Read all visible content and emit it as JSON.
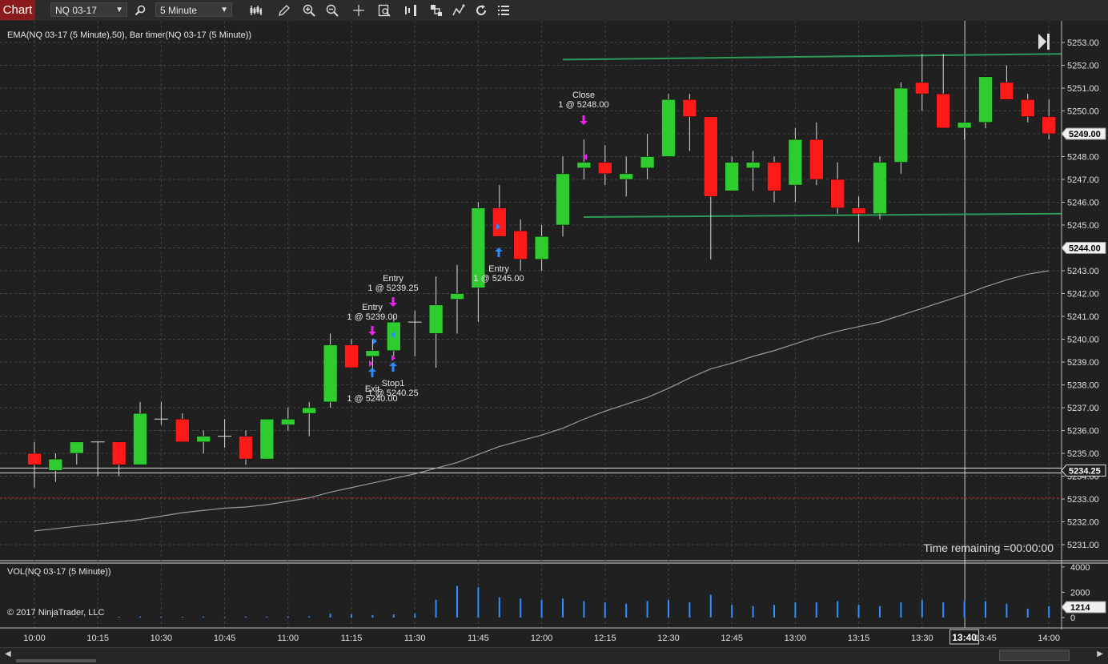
{
  "toolbar": {
    "tab_label": "Chart",
    "instrument": "NQ 03-17",
    "interval": "5 Minute",
    "icons": [
      "search-icon",
      "bars-type-icon",
      "pencil-icon",
      "zoom-in-icon",
      "zoom-out-icon",
      "crosshair-icon",
      "data-box-icon",
      "chart-trader-icon",
      "strategies-icon",
      "indicators-icon",
      "refresh-icon",
      "properties-icon"
    ]
  },
  "chart": {
    "indicator_label": "EMA(NQ 03-17 (5 Minute),50), Bar timer(NQ 03-17 (5 Minute))",
    "volume_label": "VOL(NQ 03-17 (5 Minute))",
    "copyright": "© 2017 NinjaTrader, LLC",
    "time_remaining": "Time remaining =00:00:00",
    "y_ticks": [
      "5253.00",
      "5252.00",
      "5251.00",
      "5250.00",
      "5249.00",
      "5248.00",
      "5247.00",
      "5246.00",
      "5245.00",
      "5244.00",
      "5243.00",
      "5242.00",
      "5241.00",
      "5240.00",
      "5239.00",
      "5238.00",
      "5237.00",
      "5236.00",
      "5235.00",
      "5234.00",
      "5233.00",
      "5232.00",
      "5231.00"
    ],
    "price_flags": [
      "5249.00",
      "5244.00",
      "5234.25"
    ],
    "vol_ticks": [
      "4000",
      "2000",
      "0"
    ],
    "vol_flag": "1214",
    "x_ticks": [
      "10:00",
      "10:15",
      "10:30",
      "10:45",
      "11:00",
      "11:15",
      "11:30",
      "11:45",
      "12:00",
      "12:15",
      "12:30",
      "12:45",
      "13:00",
      "13:15",
      "13:30",
      "13:40",
      "13:45",
      "14:00"
    ],
    "colors": {
      "up": "#2fcc2f",
      "down": "#ff1a1a",
      "volume": "#2f8fff",
      "ema": "#9a9a9a",
      "hline": "#2e9a5a"
    }
  },
  "chart_data": {
    "type": "candlestick",
    "instrument": "NQ 03-17",
    "interval": "5 Minute",
    "y_range": [
      5230.5,
      5253.5
    ],
    "bars": [
      {
        "t": "10:00",
        "o": 5235.0,
        "h": 5235.5,
        "l": 5233.5,
        "c": 5234.5
      },
      {
        "t": "10:05",
        "o": 5234.25,
        "h": 5235.0,
        "l": 5233.75,
        "c": 5234.75
      },
      {
        "t": "10:10",
        "o": 5235.0,
        "h": 5235.5,
        "l": 5234.5,
        "c": 5235.5
      },
      {
        "t": "10:15",
        "o": 5235.5,
        "h": 5235.5,
        "l": 5234.0,
        "c": 5235.5
      },
      {
        "t": "10:20",
        "o": 5235.5,
        "h": 5235.5,
        "l": 5234.0,
        "c": 5234.5
      },
      {
        "t": "10:25",
        "o": 5234.5,
        "h": 5237.25,
        "l": 5234.5,
        "c": 5236.75
      },
      {
        "t": "10:30",
        "o": 5236.5,
        "h": 5237.25,
        "l": 5236.25,
        "c": 5236.5
      },
      {
        "t": "10:35",
        "o": 5236.5,
        "h": 5236.75,
        "l": 5235.5,
        "c": 5235.5
      },
      {
        "t": "10:40",
        "o": 5235.5,
        "h": 5236.0,
        "l": 5235.0,
        "c": 5235.75
      },
      {
        "t": "10:45",
        "o": 5235.75,
        "h": 5236.5,
        "l": 5235.25,
        "c": 5235.75
      },
      {
        "t": "10:50",
        "o": 5235.75,
        "h": 5236.0,
        "l": 5234.5,
        "c": 5234.75
      },
      {
        "t": "10:55",
        "o": 5234.75,
        "h": 5236.5,
        "l": 5234.75,
        "c": 5236.5
      },
      {
        "t": "11:00",
        "o": 5236.25,
        "h": 5237.0,
        "l": 5236.0,
        "c": 5236.5
      },
      {
        "t": "11:05",
        "o": 5236.75,
        "h": 5237.25,
        "l": 5235.75,
        "c": 5237.0
      },
      {
        "t": "11:10",
        "o": 5237.25,
        "h": 5240.25,
        "l": 5237.0,
        "c": 5239.75
      },
      {
        "t": "11:15",
        "o": 5239.75,
        "h": 5240.0,
        "l": 5238.75,
        "c": 5238.75
      },
      {
        "t": "11:20",
        "o": 5239.25,
        "h": 5240.0,
        "l": 5238.5,
        "c": 5239.5
      },
      {
        "t": "11:25",
        "o": 5239.5,
        "h": 5241.0,
        "l": 5239.25,
        "c": 5240.75
      },
      {
        "t": "11:30",
        "o": 5240.75,
        "h": 5241.25,
        "l": 5239.25,
        "c": 5240.75
      },
      {
        "t": "11:35",
        "o": 5240.25,
        "h": 5242.75,
        "l": 5238.75,
        "c": 5241.5
      },
      {
        "t": "11:40",
        "o": 5241.75,
        "h": 5243.25,
        "l": 5240.25,
        "c": 5242.0
      },
      {
        "t": "11:45",
        "o": 5242.25,
        "h": 5246.0,
        "l": 5240.75,
        "c": 5245.75
      },
      {
        "t": "11:50",
        "o": 5245.75,
        "h": 5246.75,
        "l": 5244.5,
        "c": 5244.5
      },
      {
        "t": "11:55",
        "o": 5244.75,
        "h": 5245.25,
        "l": 5243.0,
        "c": 5243.5
      },
      {
        "t": "12:00",
        "o": 5243.5,
        "h": 5245.0,
        "l": 5243.0,
        "c": 5244.5
      },
      {
        "t": "12:05",
        "o": 5245.0,
        "h": 5248.0,
        "l": 5244.5,
        "c": 5247.25
      },
      {
        "t": "12:10",
        "o": 5247.5,
        "h": 5248.75,
        "l": 5247.0,
        "c": 5247.75
      },
      {
        "t": "12:15",
        "o": 5247.75,
        "h": 5248.5,
        "l": 5246.75,
        "c": 5247.25
      },
      {
        "t": "12:20",
        "o": 5247.0,
        "h": 5248.0,
        "l": 5246.25,
        "c": 5247.25
      },
      {
        "t": "12:25",
        "o": 5247.5,
        "h": 5249.0,
        "l": 5247.0,
        "c": 5248.0
      },
      {
        "t": "12:30",
        "o": 5248.0,
        "h": 5250.75,
        "l": 5248.0,
        "c": 5250.5
      },
      {
        "t": "12:35",
        "o": 5250.5,
        "h": 5250.75,
        "l": 5248.25,
        "c": 5249.75
      },
      {
        "t": "12:40",
        "o": 5249.75,
        "h": 5249.75,
        "l": 5243.5,
        "c": 5246.25
      },
      {
        "t": "12:45",
        "o": 5246.5,
        "h": 5248.0,
        "l": 5246.5,
        "c": 5247.75
      },
      {
        "t": "12:50",
        "o": 5247.5,
        "h": 5248.25,
        "l": 5246.5,
        "c": 5247.75
      },
      {
        "t": "12:55",
        "o": 5247.75,
        "h": 5248.0,
        "l": 5246.0,
        "c": 5246.5
      },
      {
        "t": "13:00",
        "o": 5246.75,
        "h": 5249.25,
        "l": 5246.0,
        "c": 5248.75
      },
      {
        "t": "13:05",
        "o": 5248.75,
        "h": 5249.5,
        "l": 5246.75,
        "c": 5247.0
      },
      {
        "t": "13:10",
        "o": 5247.0,
        "h": 5247.75,
        "l": 5245.5,
        "c": 5245.75
      },
      {
        "t": "13:15",
        "o": 5245.75,
        "h": 5246.25,
        "l": 5244.25,
        "c": 5245.5
      },
      {
        "t": "13:20",
        "o": 5245.5,
        "h": 5248.0,
        "l": 5245.25,
        "c": 5247.75
      },
      {
        "t": "13:25",
        "o": 5247.75,
        "h": 5251.25,
        "l": 5247.25,
        "c": 5251.0
      },
      {
        "t": "13:30",
        "o": 5251.25,
        "h": 5252.5,
        "l": 5250.0,
        "c": 5250.75
      },
      {
        "t": "13:35",
        "o": 5250.75,
        "h": 5252.5,
        "l": 5249.25,
        "c": 5249.25
      },
      {
        "t": "13:40",
        "o": 5249.25,
        "h": 5249.5,
        "l": 5248.75,
        "c": 5249.5
      },
      {
        "t": "13:45",
        "o": 5249.5,
        "h": 5251.5,
        "l": 5249.25,
        "c": 5251.5
      },
      {
        "t": "13:50",
        "o": 5251.25,
        "h": 5252.0,
        "l": 5250.5,
        "c": 5250.5
      },
      {
        "t": "13:55",
        "o": 5250.5,
        "h": 5250.75,
        "l": 5249.5,
        "c": 5249.75
      },
      {
        "t": "14:00",
        "o": 5249.75,
        "h": 5250.5,
        "l": 5248.75,
        "c": 5249.0
      }
    ],
    "volume": [
      50,
      40,
      60,
      50,
      60,
      80,
      70,
      60,
      70,
      60,
      70,
      70,
      80,
      100,
      300,
      250,
      200,
      250,
      300,
      1400,
      2500,
      2400,
      1600,
      1500,
      1400,
      1500,
      1300,
      1200,
      1100,
      1300,
      1400,
      1200,
      1800,
      1000,
      900,
      1000,
      1200,
      1200,
      1300,
      1000,
      900,
      1200,
      1400,
      1200,
      1300,
      1300,
      1100,
      700,
      900
    ],
    "ema": [
      5231.6,
      5231.7,
      5231.8,
      5231.9,
      5232.0,
      5232.1,
      5232.25,
      5232.4,
      5232.5,
      5232.6,
      5232.65,
      5232.75,
      5232.9,
      5233.05,
      5233.3,
      5233.5,
      5233.7,
      5233.9,
      5234.1,
      5234.35,
      5234.6,
      5234.95,
      5235.3,
      5235.55,
      5235.8,
      5236.1,
      5236.5,
      5236.85,
      5237.15,
      5237.45,
      5237.85,
      5238.3,
      5238.7,
      5238.95,
      5239.25,
      5239.5,
      5239.8,
      5240.1,
      5240.35,
      5240.55,
      5240.75,
      5241.05,
      5241.35,
      5241.65,
      5241.95,
      5242.3,
      5242.6,
      5242.85,
      5243.0
    ],
    "horizontal_lines": [
      {
        "y1": 5252.25,
        "y2": 5252.5,
        "style": "green"
      },
      {
        "y1": 5245.35,
        "y2": 5245.5,
        "style": "green"
      },
      {
        "y": 5234.25,
        "style": "white"
      },
      {
        "y": 5233.05,
        "style": "red-dashed"
      }
    ],
    "executions": [
      {
        "label": "Entry",
        "detail": "1 @ 5239.00"
      },
      {
        "label": "Entry",
        "detail": "1 @ 5239.25"
      },
      {
        "label": "Exit",
        "detail": "1 @ 5240.00"
      },
      {
        "label": "Stop1",
        "detail": "1 @ 5240.25"
      },
      {
        "label": "Entry",
        "detail": "1 @ 5245.00"
      },
      {
        "label": "Close",
        "detail": "1 @ 5248.00"
      }
    ],
    "last_price": 5249.0,
    "vol_range": [
      0,
      4800
    ]
  }
}
